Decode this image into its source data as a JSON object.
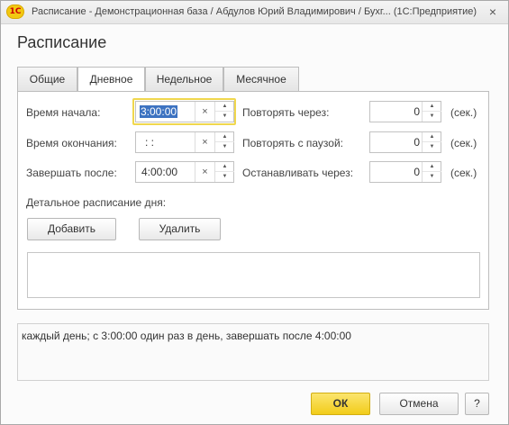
{
  "window": {
    "app_logo": "1С",
    "title": "Расписание - Демонстрационная база / Абдулов Юрий Владимирович / Бухг...  (1С:Предприятие)",
    "close_icon": "×"
  },
  "form": {
    "title": "Расписание",
    "tabs": [
      {
        "label": "Общие"
      },
      {
        "label": "Дневное",
        "active": true
      },
      {
        "label": "Недельное"
      },
      {
        "label": "Месячное"
      }
    ]
  },
  "daily": {
    "start_time_label": "Время начала:",
    "start_time_value": "3:00:00",
    "end_time_label": "Время окончания:",
    "end_time_value": " :  :",
    "finish_after_label": "Завершать после:",
    "finish_after_value": "4:00:00",
    "repeat_every_label": "Повторять через:",
    "repeat_every_value": "0",
    "repeat_pause_label": "Повторять с паузой:",
    "repeat_pause_value": "0",
    "stop_after_label": "Останавливать через:",
    "stop_after_value": "0",
    "unit_label": "(сек.)",
    "clear_icon": "×",
    "detail_label": "Детальное расписание дня:",
    "add_button": "Добавить",
    "delete_button": "Удалить"
  },
  "summary_text": "каждый  день; с 3:00:00 один раз в день, завершать после 4:00:00",
  "footer": {
    "ok_button": "ОК",
    "cancel_button": "Отмена",
    "help_button": "?"
  },
  "colors": {
    "accent_focus": "#f0d74d",
    "primary_button": "#f2cc1a",
    "selection": "#3d73c1"
  }
}
